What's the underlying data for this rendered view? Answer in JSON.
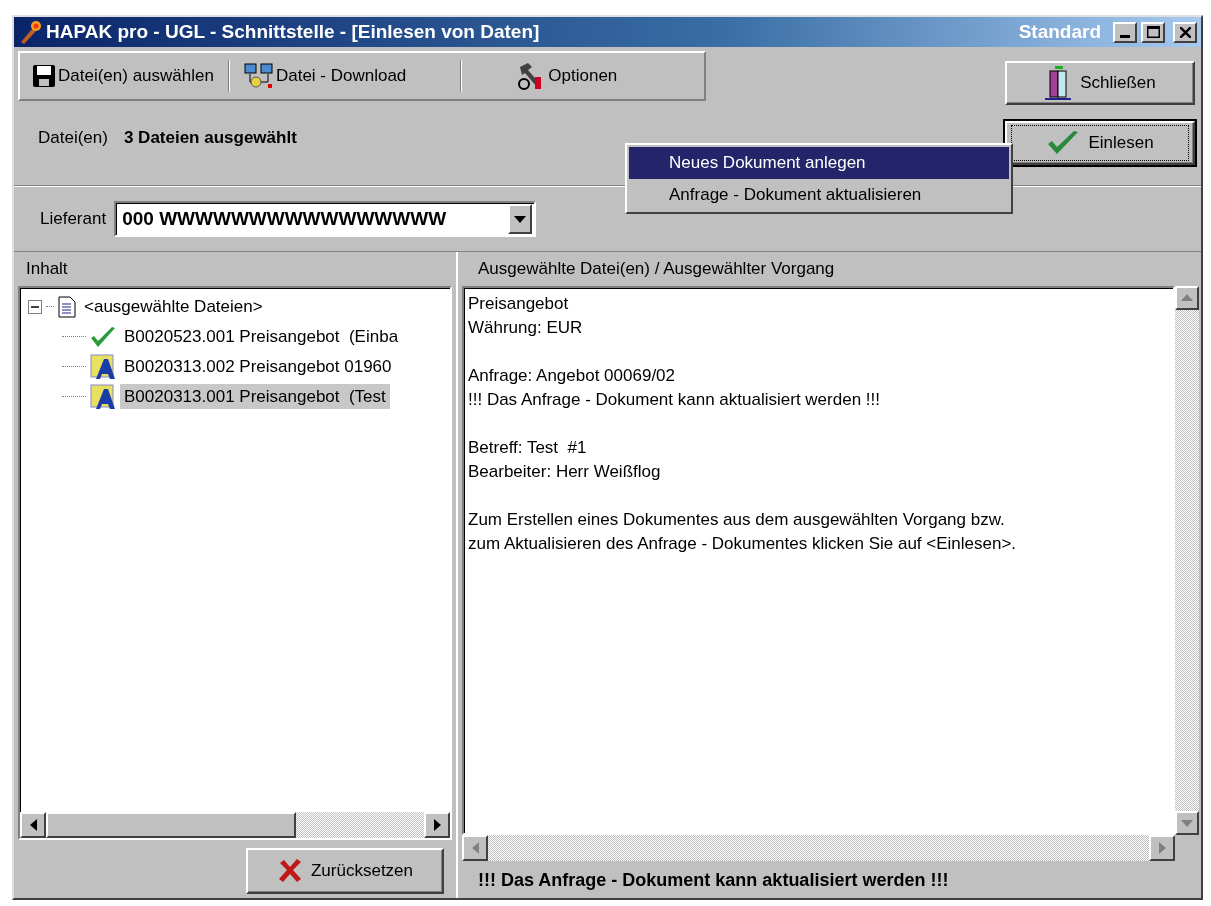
{
  "window": {
    "title": "HAPAK pro - UGL - Schnittstelle - [Einlesen von Daten]",
    "layout_label": "Standard"
  },
  "toolbar": [
    {
      "kind": "floppy",
      "label": "Datei(en) auswählen"
    },
    {
      "kind": "download",
      "label": "Datei - Download"
    },
    {
      "kind": "tools",
      "label": "Optionen"
    }
  ],
  "files": {
    "label": "Datei(en)",
    "value": "3 Dateien ausgewählt"
  },
  "supplier": {
    "label": "Lieferant",
    "value": "000 WWWWWWWWWWWWWWWW"
  },
  "buttons": [
    {
      "kind": "close",
      "label": "Schließen",
      "default": false
    },
    {
      "kind": "check",
      "label": "Einlesen",
      "default": true
    }
  ],
  "menu": [
    {
      "label": "Neues Dokument anlegen",
      "selected": true
    },
    {
      "label": "Anfrage - Dokument aktualisieren",
      "selected": false
    }
  ],
  "tree_panel": {
    "title": "Inhalt",
    "tree": [
      {
        "label": "<ausgewählte Dateien>",
        "kind": "folder",
        "expanded": true,
        "selected": false,
        "children": [
          {
            "label": "B0020523.001 Preisangebot  (Einba",
            "kind": "check",
            "selected": false
          },
          {
            "label": "B0020313.002 Preisangebot 01960",
            "kind": "document",
            "selected": false
          },
          {
            "label": "B0020313.001 Preisangebot  (Test",
            "kind": "document",
            "selected": true
          }
        ]
      }
    ],
    "reset_button": "Zurücksetzen"
  },
  "detail_panel": {
    "title": "Ausgewählte Datei(en) / Ausgewählter Vorgang",
    "paragraphs": [
      [
        "Preisangebot",
        "Währung: EUR"
      ],
      [
        "Anfrage: Angebot 00069/02",
        "!!! Das Anfrage - Dokument kann aktualisiert werden !!!"
      ],
      [
        "Betreff: Test  #1",
        "Bearbeiter: Herr Weißflog"
      ],
      [
        "Zum Erstellen eines Dokumentes aus dem ausgewählten Vorgang bzw.",
        "zum Aktualisieren des Anfrage - Dokumentes klicken Sie auf <Einlesen>."
      ]
    ],
    "status": "!!! Das Anfrage - Dokument kann aktualisiert werden !!!"
  }
}
